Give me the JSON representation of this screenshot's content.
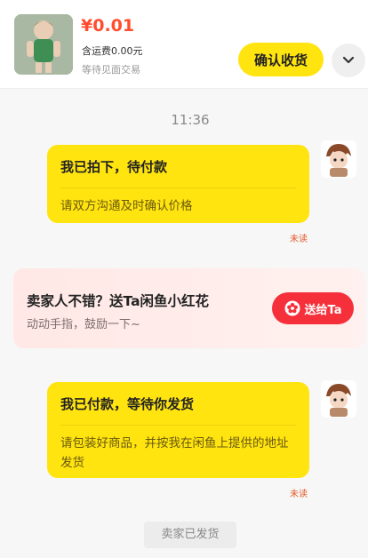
{
  "header": {
    "price": "¥0.01",
    "shipping": "含运费0.00元",
    "trade_mode": "等待见面交易",
    "confirm_label": "确认收货",
    "more_icon": "chevron-down-icon"
  },
  "chat": {
    "time": "11:36",
    "messages": [
      {
        "title": "我已拍下，待付款",
        "body": "请双方沟通及时确认价格",
        "status": "未读"
      },
      {
        "title": "我已付款，等待你发货",
        "body": "请包装好商品，并按我在闲鱼上提供的地址发货",
        "status": "未读"
      }
    ],
    "promo": {
      "title": "卖家人不错？送Ta闲鱼小红花",
      "subtitle": "动动手指，鼓励一下~",
      "button_label": "送给Ta",
      "button_icon": "flower-icon"
    },
    "system_notice": "卖家已发货"
  },
  "colors": {
    "accent_yellow": "#ffe40f",
    "price_red": "#ff4d2e",
    "promo_red": "#f5303a"
  }
}
